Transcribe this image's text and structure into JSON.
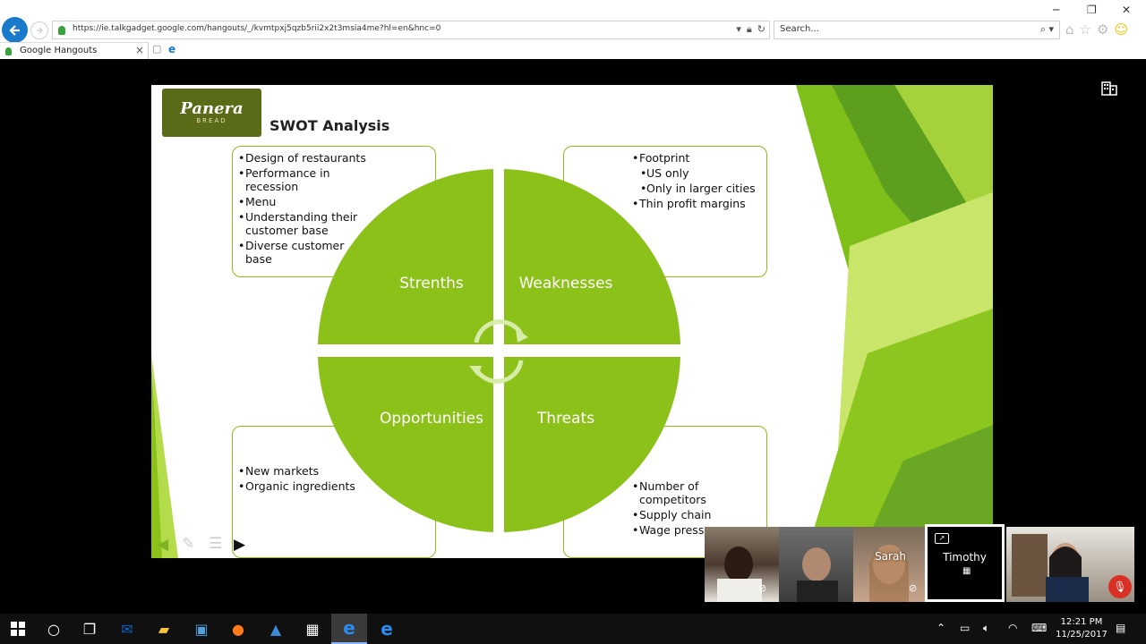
{
  "browser": {
    "url": "https://ie.talkgadget.google.com/hangouts/_/kvmtpxj5qzb5rii2x2t3msia4me?hl=en&hnc=0",
    "search_placeholder": "Search...",
    "tab_title": "Google Hangouts"
  },
  "slide": {
    "logo_text": "Panera",
    "logo_sub": "BREAD",
    "title": "SWOT Analysis",
    "strengths": {
      "label": "Strenths",
      "items": [
        "Design of restaurants",
        "Performance in",
        "recession",
        "Menu",
        "Understanding their",
        "customer base",
        "Diverse customer",
        "base"
      ]
    },
    "weaknesses": {
      "label": "Weaknesses",
      "items": [
        "Footprint",
        "US only",
        "Only in larger cities",
        "Thin profit margins"
      ]
    },
    "opportunities": {
      "label": "Opportunities",
      "items": [
        "New markets",
        "Organic ingredients"
      ]
    },
    "threats": {
      "label": "Threats",
      "items": [
        "Number of",
        "competitors",
        "Supply chain",
        "Wage pressu"
      ]
    },
    "accent_color": "#8cc11a"
  },
  "participants": [
    {
      "name": ""
    },
    {
      "name": ""
    },
    {
      "name": "Sarah"
    },
    {
      "name": "Timothy"
    },
    {
      "name": ""
    }
  ],
  "taskbar": {
    "time": "12:21 PM",
    "date": "11/25/2017"
  }
}
